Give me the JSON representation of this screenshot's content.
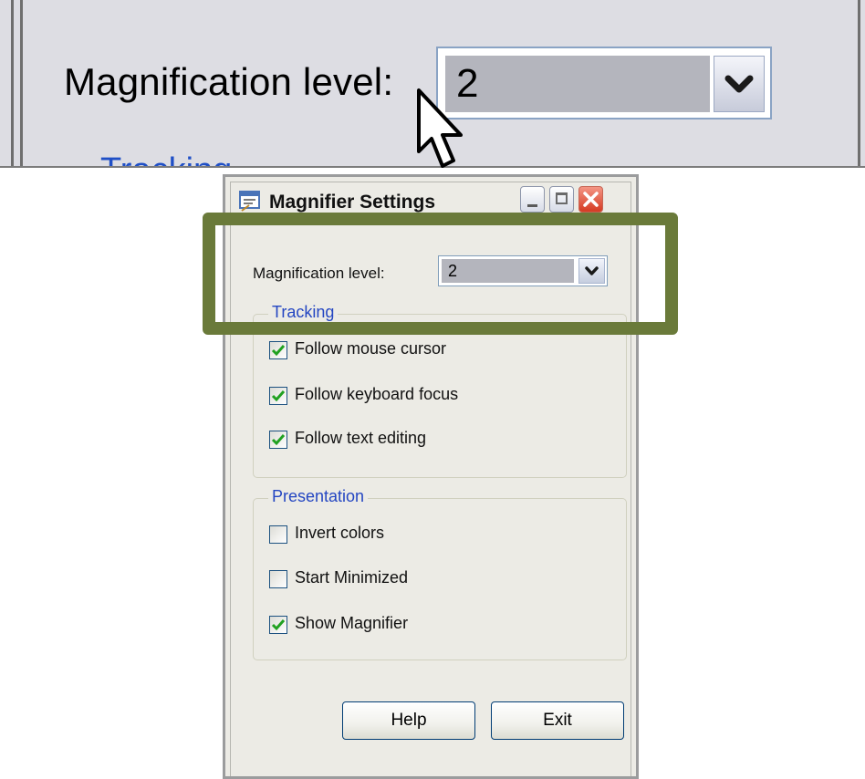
{
  "zoom": {
    "label": "Magnification level:",
    "value": "2",
    "tracking_label": "Tracking"
  },
  "dialog": {
    "title": "Magnifier Settings",
    "magnification": {
      "label": "Magnification level:",
      "value": "2"
    },
    "tracking": {
      "title": "Tracking",
      "items": [
        {
          "label": "Follow mouse cursor",
          "checked": true
        },
        {
          "label": "Follow keyboard focus",
          "checked": true
        },
        {
          "label": "Follow text editing",
          "checked": true
        }
      ]
    },
    "presentation": {
      "title": "Presentation",
      "items": [
        {
          "label": "Invert colors",
          "checked": false
        },
        {
          "label": "Start Minimized",
          "checked": false
        },
        {
          "label": "Show Magnifier",
          "checked": true
        }
      ]
    },
    "buttons": {
      "help": "Help",
      "exit": "Exit"
    }
  },
  "colors": {
    "highlight_frame": "#6a7a3a",
    "check_mark": "#21a121",
    "group_title": "#2446c2"
  },
  "icons": {
    "cursor": "arrow-pointer-icon",
    "app": "magnifier-app-icon",
    "dropdown": "chevron-down-icon"
  }
}
